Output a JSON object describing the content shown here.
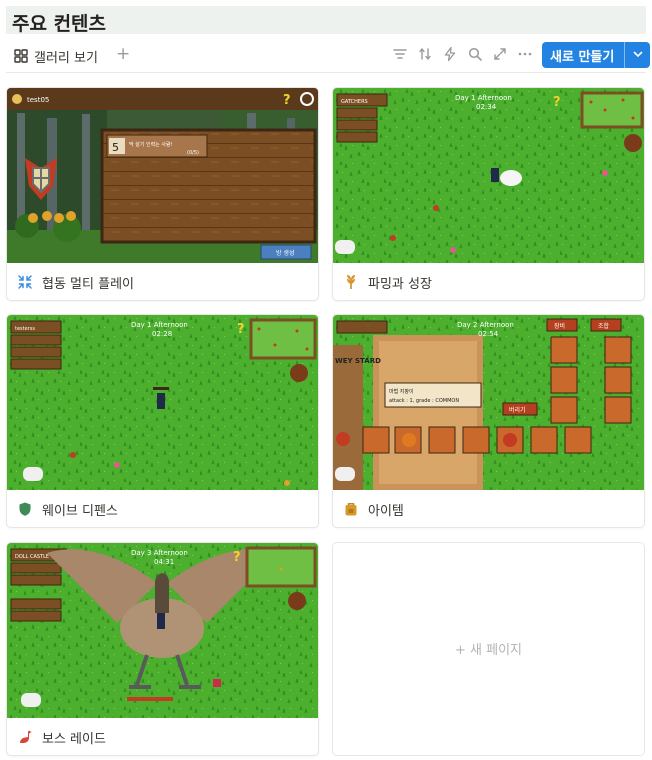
{
  "page": {
    "title": "주요 컨텐츠"
  },
  "toolbar": {
    "view_label": "갤러리 보기",
    "add_view": "+",
    "new_button": "새로 만들기",
    "icons": [
      "filter-icon",
      "sort-icon",
      "automation-icon",
      "search-icon",
      "expand-icon",
      "more-icon"
    ]
  },
  "colors": {
    "accent": "#2383e2",
    "grass": "#4caf2e",
    "wood": "#8a5a2b"
  },
  "cards": [
    {
      "title": "협동 멀티 플레이",
      "icon": "collapse-arrows-icon",
      "cover": {
        "player_name": "test05",
        "board_number": "5",
        "board_text": "막 살기 인력는 사람!",
        "board_count": "(0/5)",
        "button_text": "방 생성"
      }
    },
    {
      "title": "파밍과 성장",
      "icon": "wheat-icon",
      "cover": {
        "hud_day": "Day 1 Afternoon",
        "hud_time": "02:34",
        "tag": "GATCHERS"
      }
    },
    {
      "title": "웨이브 디펜스",
      "icon": "shield-icon",
      "cover": {
        "hud_day": "Day 1 Afternoon",
        "hud_time": "02:28",
        "tag": "testerss"
      }
    },
    {
      "title": "아이템",
      "icon": "backpack-icon",
      "cover": {
        "hud_day": "Day 2 Afternoon",
        "hud_time": "02:54",
        "tab_equip": "장비",
        "tab_combine": "조합",
        "tooltip_name": "마법 지팡이",
        "tooltip_stats": "attack : 1, grade : COMMON",
        "tooltip_button": "버리기",
        "shop_sign": "WEY STARD"
      }
    },
    {
      "title": "보스 레이드",
      "icon": "bird-icon",
      "cover": {
        "hud_day": "Day 3 Afternoon",
        "hud_time": "04:31",
        "tag": "DOLL CASTLE"
      }
    }
  ],
  "new_page": "+ 새 페이지"
}
